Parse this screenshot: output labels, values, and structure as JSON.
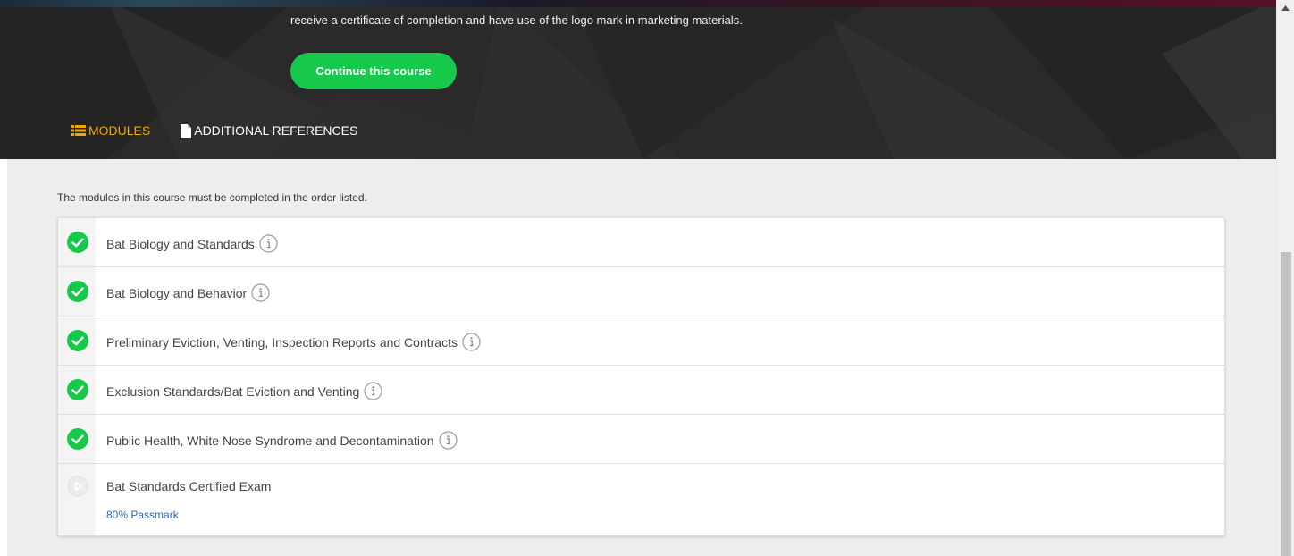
{
  "hero": {
    "description": "receive a certificate of completion and have use of the logo mark in marketing materials.",
    "continue_button": "Continue this course",
    "tabs": [
      {
        "label": "MODULES",
        "icon": "list-icon",
        "active": true
      },
      {
        "label": "ADDITIONAL REFERENCES",
        "icon": "document-icon",
        "active": false
      }
    ]
  },
  "main": {
    "intro": "The modules in this course must be completed in the order listed.",
    "modules": [
      {
        "title": "Bat Biology and Standards",
        "status": "completed"
      },
      {
        "title": "Bat Biology and Behavior",
        "status": "completed"
      },
      {
        "title": "Preliminary Eviction, Venting, Inspection Reports and Contracts",
        "status": "completed"
      },
      {
        "title": "Exclusion Standards/Bat Eviction and Venting",
        "status": "completed"
      },
      {
        "title": "Public Health, White Nose Syndrome and Decontamination",
        "status": "completed"
      },
      {
        "title": "Bat Standards Certified Exam",
        "status": "not-started",
        "passmark": "80% Passmark"
      }
    ]
  },
  "colors": {
    "accent_green": "#17c94a",
    "active_tab": "#f0a800",
    "link_blue": "#2d6bb5"
  }
}
